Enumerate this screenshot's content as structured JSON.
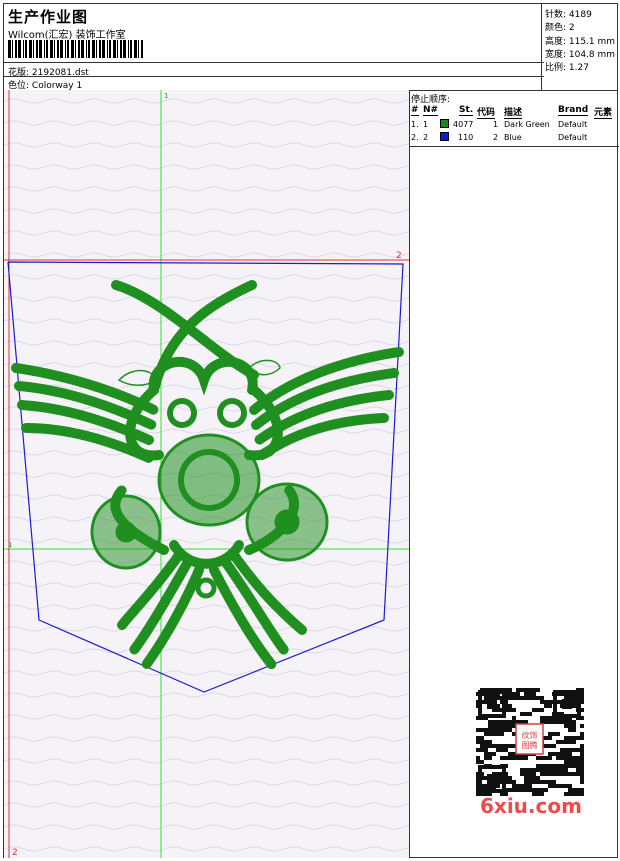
{
  "header": {
    "title": "生产作业图",
    "studio": "Wilcom(汇宏) 装饰工作室",
    "design_label": "花版:",
    "design_value": "2192081.dst",
    "colorway_label": "色位:",
    "colorway_value": "Colorway 1"
  },
  "stats": {
    "stitches": "针数: 4189",
    "colors": "颜色: 2",
    "height": "高度: 115.1 mm",
    "width": "宽度: 104.8 mm",
    "scale": "比例: 1.27"
  },
  "stop_sequence": {
    "title": "停止顺序:",
    "headers": [
      "#",
      "N#",
      "St.",
      "代码",
      "描述",
      "Brand",
      "元素"
    ],
    "rows": [
      {
        "idx": "1.",
        "n": "1",
        "color": "#1a8a1a",
        "st": "4077",
        "code": "1",
        "desc": "Dark Green",
        "brand": "Default"
      },
      {
        "idx": "2.",
        "n": "2",
        "color": "#0a1adf",
        "st": "110",
        "code": "2",
        "desc": "Blue",
        "brand": "Default"
      }
    ]
  },
  "canvas": {
    "guide_top": "1",
    "guide_left": "1",
    "guide_right": "2",
    "guide_bottom": "2"
  },
  "watermark": {
    "qr_badge": "纹饰图腾",
    "site": "6xiu.com"
  }
}
